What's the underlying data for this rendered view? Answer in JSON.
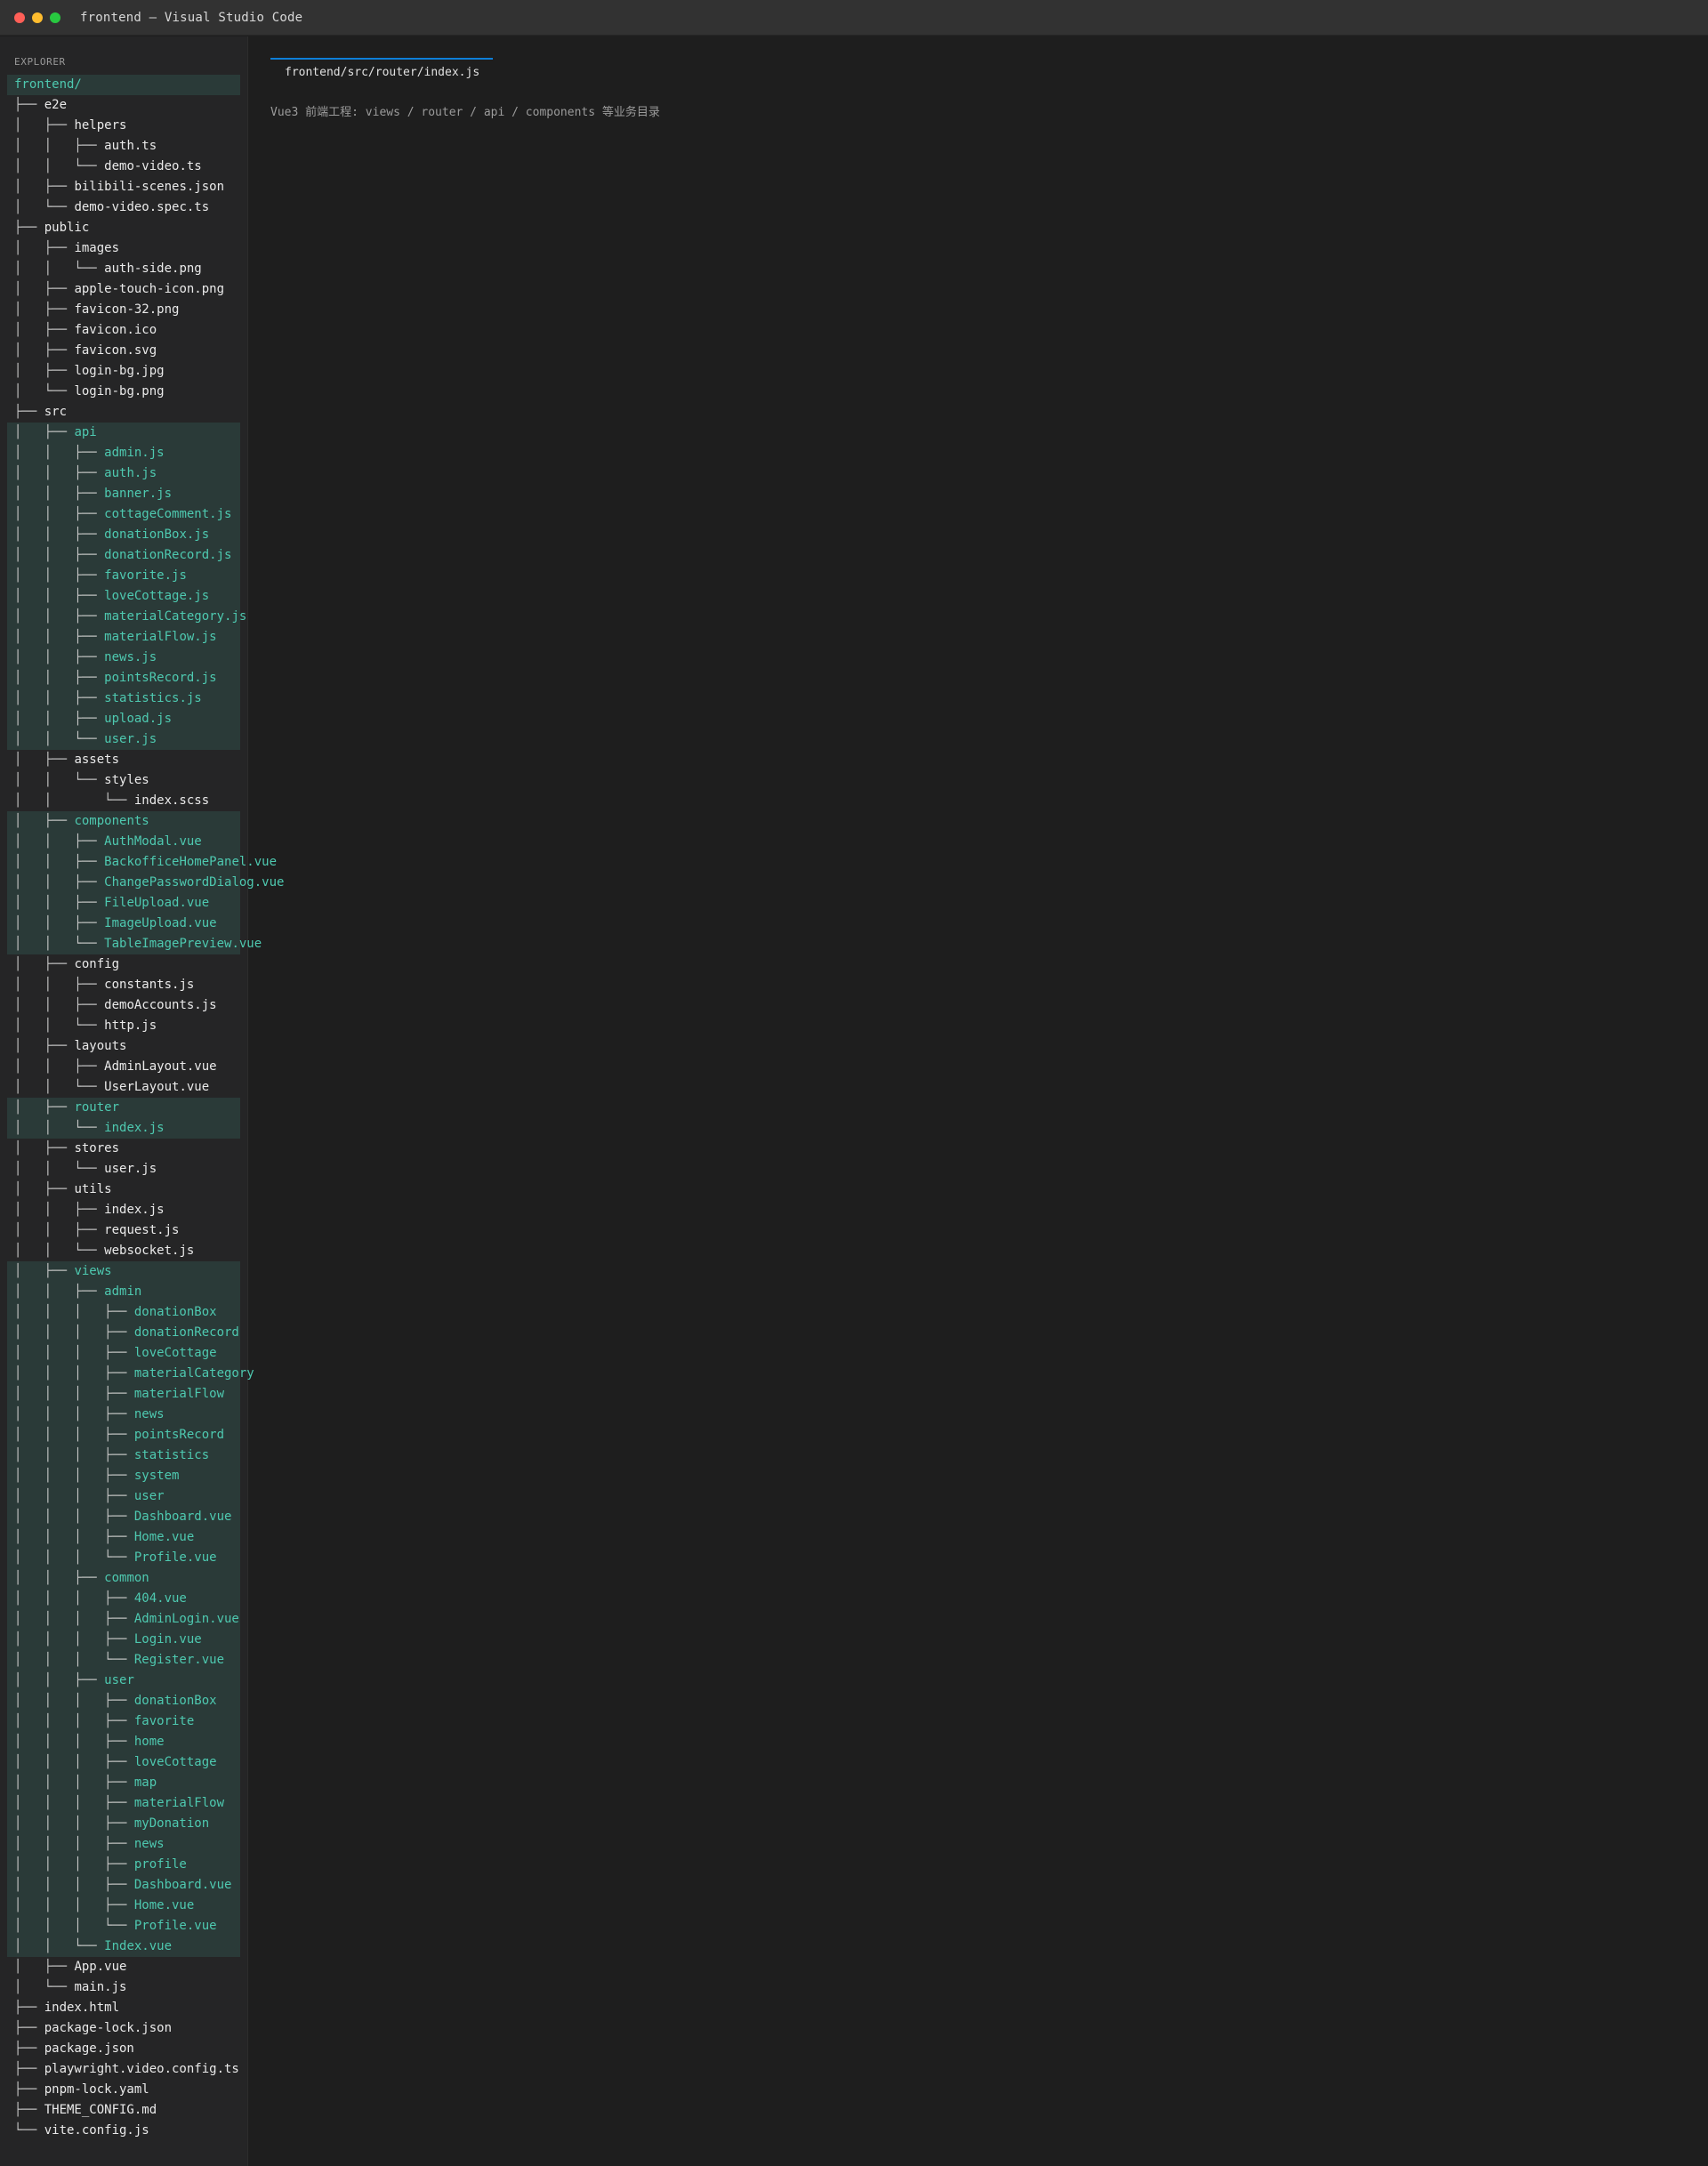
{
  "window": {
    "title": "frontend — Visual Studio Code"
  },
  "sidebar": {
    "label": "EXPLORER",
    "tree": [
      {
        "prefix": "",
        "name": "frontend/",
        "hl": true
      },
      {
        "prefix": "├── ",
        "name": "e2e"
      },
      {
        "prefix": "│   ├── ",
        "name": "helpers"
      },
      {
        "prefix": "│   │   ├── ",
        "name": "auth.ts"
      },
      {
        "prefix": "│   │   └── ",
        "name": "demo-video.ts"
      },
      {
        "prefix": "│   ├── ",
        "name": "bilibili-scenes.json"
      },
      {
        "prefix": "│   └── ",
        "name": "demo-video.spec.ts"
      },
      {
        "prefix": "├── ",
        "name": "public"
      },
      {
        "prefix": "│   ├── ",
        "name": "images"
      },
      {
        "prefix": "│   │   └── ",
        "name": "auth-side.png"
      },
      {
        "prefix": "│   ├── ",
        "name": "apple-touch-icon.png"
      },
      {
        "prefix": "│   ├── ",
        "name": "favicon-32.png"
      },
      {
        "prefix": "│   ├── ",
        "name": "favicon.ico"
      },
      {
        "prefix": "│   ├── ",
        "name": "favicon.svg"
      },
      {
        "prefix": "│   ├── ",
        "name": "login-bg.jpg"
      },
      {
        "prefix": "│   └── ",
        "name": "login-bg.png"
      },
      {
        "prefix": "├── ",
        "name": "src"
      },
      {
        "prefix": "│   ├── ",
        "name": "api",
        "hl": true
      },
      {
        "prefix": "│   │   ├── ",
        "name": "admin.js",
        "hl": true
      },
      {
        "prefix": "│   │   ├── ",
        "name": "auth.js",
        "hl": true
      },
      {
        "prefix": "│   │   ├── ",
        "name": "banner.js",
        "hl": true
      },
      {
        "prefix": "│   │   ├── ",
        "name": "cottageComment.js",
        "hl": true
      },
      {
        "prefix": "│   │   ├── ",
        "name": "donationBox.js",
        "hl": true
      },
      {
        "prefix": "│   │   ├── ",
        "name": "donationRecord.js",
        "hl": true
      },
      {
        "prefix": "│   │   ├── ",
        "name": "favorite.js",
        "hl": true
      },
      {
        "prefix": "│   │   ├── ",
        "name": "loveCottage.js",
        "hl": true
      },
      {
        "prefix": "│   │   ├── ",
        "name": "materialCategory.js",
        "hl": true
      },
      {
        "prefix": "│   │   ├── ",
        "name": "materialFlow.js",
        "hl": true
      },
      {
        "prefix": "│   │   ├── ",
        "name": "news.js",
        "hl": true
      },
      {
        "prefix": "│   │   ├── ",
        "name": "pointsRecord.js",
        "hl": true
      },
      {
        "prefix": "│   │   ├── ",
        "name": "statistics.js",
        "hl": true
      },
      {
        "prefix": "│   │   ├── ",
        "name": "upload.js",
        "hl": true
      },
      {
        "prefix": "│   │   └── ",
        "name": "user.js",
        "hl": true
      },
      {
        "prefix": "│   ├── ",
        "name": "assets"
      },
      {
        "prefix": "│   │   └── ",
        "name": "styles"
      },
      {
        "prefix": "│   │       └── ",
        "name": "index.scss"
      },
      {
        "prefix": "│   ├── ",
        "name": "components",
        "hl": true
      },
      {
        "prefix": "│   │   ├── ",
        "name": "AuthModal.vue",
        "hl": true
      },
      {
        "prefix": "│   │   ├── ",
        "name": "BackofficeHomePanel.vue",
        "hl": true
      },
      {
        "prefix": "│   │   ├── ",
        "name": "ChangePasswordDialog.vue",
        "hl": true
      },
      {
        "prefix": "│   │   ├── ",
        "name": "FileUpload.vue",
        "hl": true
      },
      {
        "prefix": "│   │   ├── ",
        "name": "ImageUpload.vue",
        "hl": true
      },
      {
        "prefix": "│   │   └── ",
        "name": "TableImagePreview.vue",
        "hl": true
      },
      {
        "prefix": "│   ├── ",
        "name": "config"
      },
      {
        "prefix": "│   │   ├── ",
        "name": "constants.js"
      },
      {
        "prefix": "│   │   ├── ",
        "name": "demoAccounts.js"
      },
      {
        "prefix": "│   │   └── ",
        "name": "http.js"
      },
      {
        "prefix": "│   ├── ",
        "name": "layouts"
      },
      {
        "prefix": "│   │   ├── ",
        "name": "AdminLayout.vue"
      },
      {
        "prefix": "│   │   └── ",
        "name": "UserLayout.vue"
      },
      {
        "prefix": "│   ├── ",
        "name": "router",
        "hl": true
      },
      {
        "prefix": "│   │   └── ",
        "name": "index.js",
        "hl": true
      },
      {
        "prefix": "│   ├── ",
        "name": "stores"
      },
      {
        "prefix": "│   │   └── ",
        "name": "user.js"
      },
      {
        "prefix": "│   ├── ",
        "name": "utils"
      },
      {
        "prefix": "│   │   ├── ",
        "name": "index.js"
      },
      {
        "prefix": "│   │   ├── ",
        "name": "request.js"
      },
      {
        "prefix": "│   │   └── ",
        "name": "websocket.js"
      },
      {
        "prefix": "│   ├── ",
        "name": "views",
        "hl": true
      },
      {
        "prefix": "│   │   ├── ",
        "name": "admin",
        "hl": true
      },
      {
        "prefix": "│   │   │   ├── ",
        "name": "donationBox",
        "hl": true
      },
      {
        "prefix": "│   │   │   ├── ",
        "name": "donationRecord",
        "hl": true
      },
      {
        "prefix": "│   │   │   ├── ",
        "name": "loveCottage",
        "hl": true
      },
      {
        "prefix": "│   │   │   ├── ",
        "name": "materialCategory",
        "hl": true
      },
      {
        "prefix": "│   │   │   ├── ",
        "name": "materialFlow",
        "hl": true
      },
      {
        "prefix": "│   │   │   ├── ",
        "name": "news",
        "hl": true
      },
      {
        "prefix": "│   │   │   ├── ",
        "name": "pointsRecord",
        "hl": true
      },
      {
        "prefix": "│   │   │   ├── ",
        "name": "statistics",
        "hl": true
      },
      {
        "prefix": "│   │   │   ├── ",
        "name": "system",
        "hl": true
      },
      {
        "prefix": "│   │   │   ├── ",
        "name": "user",
        "hl": true
      },
      {
        "prefix": "│   │   │   ├── ",
        "name": "Dashboard.vue",
        "hl": true
      },
      {
        "prefix": "│   │   │   ├── ",
        "name": "Home.vue",
        "hl": true
      },
      {
        "prefix": "│   │   │   └── ",
        "name": "Profile.vue",
        "hl": true
      },
      {
        "prefix": "│   │   ├── ",
        "name": "common",
        "hl": true
      },
      {
        "prefix": "│   │   │   ├── ",
        "name": "404.vue",
        "hl": true
      },
      {
        "prefix": "│   │   │   ├── ",
        "name": "AdminLogin.vue",
        "hl": true
      },
      {
        "prefix": "│   │   │   ├── ",
        "name": "Login.vue",
        "hl": true
      },
      {
        "prefix": "│   │   │   └── ",
        "name": "Register.vue",
        "hl": true
      },
      {
        "prefix": "│   │   ├── ",
        "name": "user",
        "hl": true
      },
      {
        "prefix": "│   │   │   ├── ",
        "name": "donationBox",
        "hl": true
      },
      {
        "prefix": "│   │   │   ├── ",
        "name": "favorite",
        "hl": true
      },
      {
        "prefix": "│   │   │   ├── ",
        "name": "home",
        "hl": true
      },
      {
        "prefix": "│   │   │   ├── ",
        "name": "loveCottage",
        "hl": true
      },
      {
        "prefix": "│   │   │   ├── ",
        "name": "map",
        "hl": true
      },
      {
        "prefix": "│   │   │   ├── ",
        "name": "materialFlow",
        "hl": true
      },
      {
        "prefix": "│   │   │   ├── ",
        "name": "myDonation",
        "hl": true
      },
      {
        "prefix": "│   │   │   ├── ",
        "name": "news",
        "hl": true
      },
      {
        "prefix": "│   │   │   ├── ",
        "name": "profile",
        "hl": true
      },
      {
        "prefix": "│   │   │   ├── ",
        "name": "Dashboard.vue",
        "hl": true
      },
      {
        "prefix": "│   │   │   ├── ",
        "name": "Home.vue",
        "hl": true
      },
      {
        "prefix": "│   │   │   └── ",
        "name": "Profile.vue",
        "hl": true
      },
      {
        "prefix": "│   │   └── ",
        "name": "Index.vue",
        "hl": true
      },
      {
        "prefix": "│   ├── ",
        "name": "App.vue"
      },
      {
        "prefix": "│   └── ",
        "name": "main.js"
      },
      {
        "prefix": "├── ",
        "name": "index.html"
      },
      {
        "prefix": "├── ",
        "name": "package-lock.json"
      },
      {
        "prefix": "├── ",
        "name": "package.json"
      },
      {
        "prefix": "├── ",
        "name": "playwright.video.config.ts"
      },
      {
        "prefix": "├── ",
        "name": "pnpm-lock.yaml"
      },
      {
        "prefix": "├── ",
        "name": "THEME_CONFIG.md"
      },
      {
        "prefix": "└── ",
        "name": "vite.config.js"
      }
    ]
  },
  "editor": {
    "active_tab": "frontend/src/router/index.js",
    "note": "Vue3 前端工程: views / router / api / components 等业务目录"
  },
  "colors": {
    "accent": "#0e7fd8",
    "highlight_text": "#4ec9b0",
    "highlight_bg": "#2a3a38"
  }
}
